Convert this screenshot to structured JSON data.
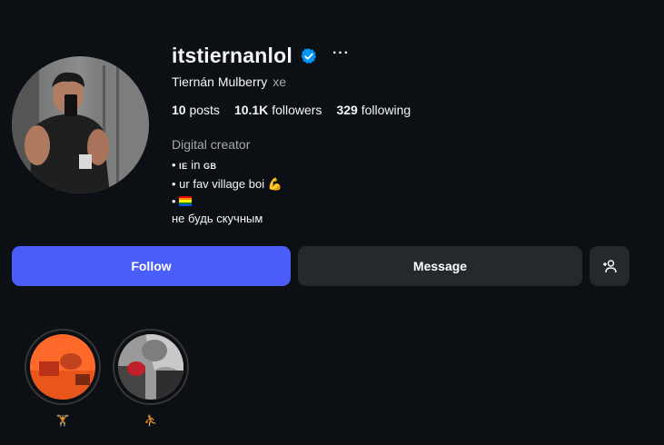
{
  "profile": {
    "username": "itstiernanlol",
    "full_name": "Tiernán Mulberry",
    "pronouns": "xe",
    "category": "Digital creator",
    "verified": true,
    "more_options": "···"
  },
  "stats": {
    "posts_count": "10",
    "posts_label": "posts",
    "followers_count": "10.1K",
    "followers_label": "followers",
    "following_count": "329",
    "following_label": "following"
  },
  "bio": {
    "line1_bullet": "• ",
    "line1_ie": "IE",
    "line1_mid": " in ",
    "line1_gb": "GB",
    "line2": "• ur fav village boi 💪",
    "line3_bullet": "• ",
    "line4": "не будь скучным"
  },
  "actions": {
    "follow_label": "Follow",
    "message_label": "Message"
  },
  "highlights": [
    {
      "label": "🏋"
    },
    {
      "label": "⛹"
    }
  ],
  "colors": {
    "background": "#0c1014",
    "follow_button": "#4a5df9",
    "secondary_button": "#25292e",
    "verified_badge": "#0095f6",
    "muted_text": "#a8a8a8"
  },
  "icons": {
    "verified": "verified-badge-icon",
    "add_user": "add-user-icon",
    "more": "more-options-icon"
  }
}
